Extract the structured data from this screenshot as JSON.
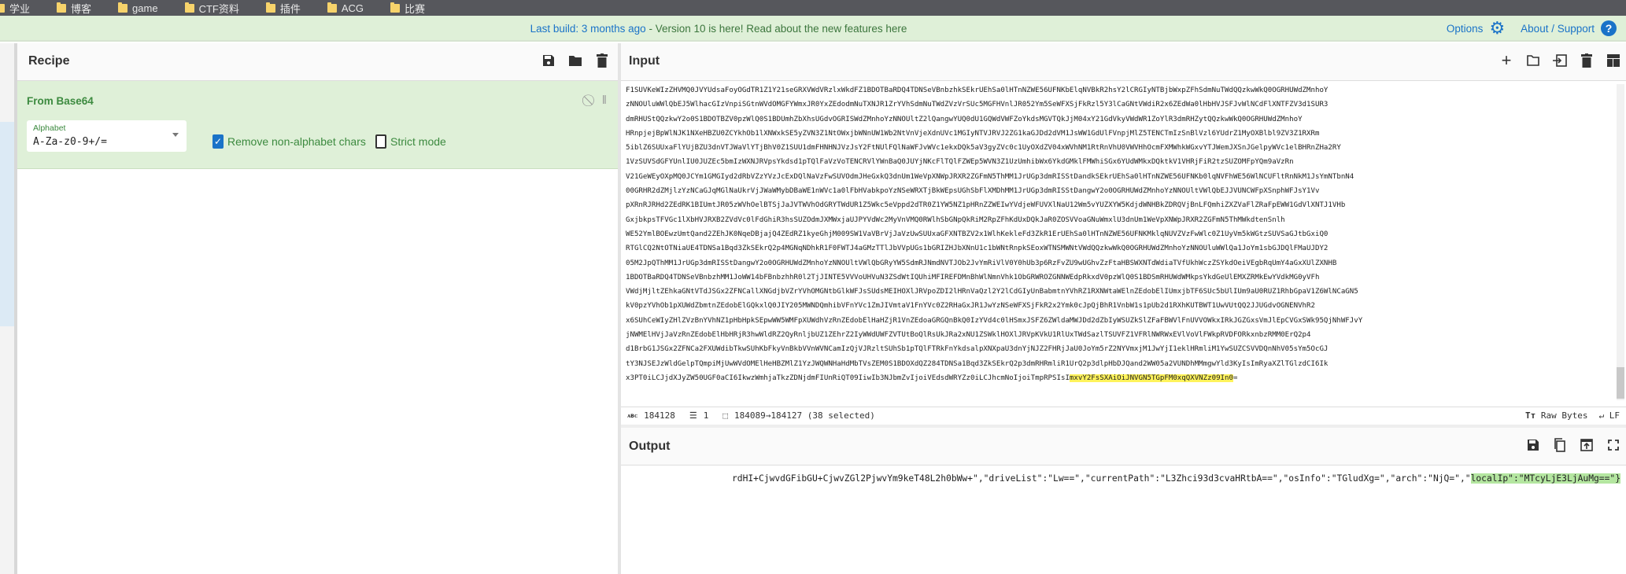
{
  "bookmarks": [
    "学业",
    "博客",
    "game",
    "CTF资料",
    "插件",
    "ACG",
    "比赛"
  ],
  "banner": {
    "last_build": "Last build: 3 months ago",
    "separator": " - ",
    "message": "Version 10 is here! Read about the new features here",
    "options": "Options",
    "about": "About / Support"
  },
  "recipe": {
    "title": "Recipe",
    "operation": {
      "name": "From Base64",
      "alphabet_label": "Alphabet",
      "alphabet_value": "A-Za-z0-9+/=",
      "remove_non_alphabet": {
        "label": "Remove non-alphabet chars",
        "checked": true
      },
      "strict_mode": {
        "label": "Strict mode",
        "checked": false
      }
    }
  },
  "input": {
    "title": "Input",
    "lines": [
      "F1SUVKeWIzZHVMQ0JVYUdsaFoyOGdTR1Z1Y21seGRXVWdVRzlxWkdFZ1BDOTBaRDQ4TDNSeVBnbzhkSEkrUEhSa0lHTnNZWE56UFNKbElqNVBkR2hsY2lCRGIyNTBjbWxpZFhSdmNuTWdQQzkwWkQ0OGRHUWdZMnhoY",
      "zNNOUluWWlQbEJ5WlhacGIzVnpiSGtnWVdOMGFYWmxJR0YxZEdodmNuTXNJR1ZrYVhSdmNuTWdZVzVrSUc5MGFHVnlJR052Ym5SeWFXSjFkRzl5Y3lCaGNtVWdiR2x6ZEdWa0lHbHVJSFJvWlNCdFlXNTFZV3d1SUR3",
      "dmRHUStQQzkwY2o0S1BDOTBZV0pzWlQ0S1BDUmhZbXhsUGdvOGRISWdZMnhoYzNNOUltZ2lQangwYUQ0dU1GQWdVWFZoYkdsMGVTQkJjM04xY21GdVkyVWdWR1ZoYlR3dmRHZytQQzkwWkQ0OGRHUWdZMnhoY",
      "HRnpjejBpWlNJK1NXeHBZU0ZCYkhOb1lXNWxkSE5yZVN3Z1NtOWxjbWNnUW1Wb2NtVnVjeXdnUVc1MGIyNTVJRVJ2ZG1kaGJDd2dVM1JsWW1GdUlFVnpjMlZ5TENCTmIzSnBlVzl6YUdrZ1MyOXBlbl9ZV3Z1RXRm",
      "5iblZ6SUUxaFlYUjBZU3dnVTJWaVlYTjBhV0Z1SUU1dmFHNHNJVzJsY2FtNUlFQlNaWFJvWVc1ekxDQk5aV3gyZVc0c1UyOXdZV04xWVhNM1RtRnVhU0VWVHhOcmFXMWhkWGxvYTJWemJXSnJGelpyWVc1elBHRnZHa2RY",
      "1VzSUVSdGFYUnlIU0JUZEc5bmIzWXNJRVpsYkdsd1pTQlFaVzVoTENCRVlYWnBaQ0JUYjNKcFlTQlFZWEp5WVN3Z1UzUmhibWx6YkdGMklFMWhiSGx6YUdWMkxDQktkV1VHRjFiR2tzSUZOMFpYQm9aVzRn",
      "V21GeWEyOXpMQ0JCYm1GMGIyd2dRbVZzYVzJcExDQlNaVzFwSUVOdmJHeGxkQ3dnUm1WeVpXNWpJRXR2ZGFmN5ThMM1JrUGp3dmRISStDandkSEkrUEhSa0lHTnNZWE56UFNKb0lqNVFhWE56WlNCUFltRnNkM1JsYmNTbnN4",
      "00GRHR2dZMjlzYzNCaGJqMGlNaUkrVjJWaWMybDBaWE1nWVc1a0lFbHVabkpoYzNSeWRXTjBkWEpsUGhSbFlXMDhMM1JrUGp3dmRISStDangwY2o0OGRHUWdZMnhoYzNNOUltVWlQbEJJVUNCWFpXSnphWFJsY1Vv",
      "pXRnRJRHd2ZEdRK1BIUmtJR05zWVhOelBTSjJaJVTWVhOdGRYTWdUR1Z5Wkc5eVppd2dTR0Z1YW5NZ1pHRnZZWEIwYVdjeWFUVXlNaU12Wm5vYUZXYW5KdjdWNHBkZDRQVjBnLFQmhiZXZVaFlZRaFpEWW1GdVlXNTJ1VHb",
      "GxjbkpsTFVGc1lXbHVJRXB2ZVdVc0lFdGhiR3hsSUZOdmJXMWxjaUJPYVdWc2MyVnVMQ0RWlhSbGNpQkRiM2RpZFhKdUxDQkJaR0ZOSVVoaGNuWmxlU3dnUm1WeVpXNWpJRXR2ZGFmN5ThMWkdtenSnlh",
      "WE52YmlBOEwzUmtQand2ZEhJK0NqeDBjajQ4ZEdRZ1kyeGhjM009SW1VaVBrVjJaVzUwSUUxaGFXNTBZV2x1WlhKekleFd3ZkR1ErUEhSa0lHTnNZWE56UFNKMklqNUVZVzFwWlc0Z1UyVm5kWGtzSUVSaGJtbGxiQ0",
      "RTGlCQ2NtOTNiaUE4TDNSa1Bqd3ZkSEkrQ2p4MGNqNDhkR1F0FWTJ4aGMzTTlJbVVpUGs1bGRIZHJbXNnU1c1bWNtRnpkSEoxWTNSMWNtVWdQQzkwWkQ0OGRHUWdZMnhoYzNNOUluWWlQa1JoYm1sbGJDQlFMaUJDY2",
      "05M2JpQThMM1JrUGp3dmRISStDangwY2o0OGRHUWdZMnhoYzNNOUltVWlQbGRyYW5SdmRJNmdNVTJOb2JvYmRiVlV0Y0hUb3p6RzFvZU9wUGhvZzFtaHBSWXNTdWdiaTVfUkhWczZSYkdOeiVEgbRqUmY4aGxXUlZXNHB",
      "1BDOTBaRDQ4TDNSeVBnbzhMM1JoWW14bFBnbzhhR0l2TjJINTE5VVVoUHVuN3ZSdWtIQUhiMFIREFDMnBhWlNmnVhk1ObGRWROZGNNWEdpRkxdV0pzWlQ0S1BDSmRHUWdWMkpsYkdGeUlEMXZRMkEwYVdkMG0yVFh",
      "VWdjMjltZEhkaGNtVTdJSGx2ZFNCallXNGdjbVZrYVhOMGNtbGlkWFJsSUdsMEIHOXlJRVpoZDI2lHRnVaQzl2Y2lCdGIyUnBabmtnYVhRZ1RXNWtaWElnZEdobElIUmxjbTF6SUc5bUlIUm9aU0RUZ1RhbGpaV1Z6WlNCaGN5",
      "kV0pzYVhOb1pXUWdZbmtnZEdobElGQkxlQ0JIY205MWNDQmhibVFnYVc1ZmJIVmtaV1FnYVc0Z2RHaGxJR1JwYzNSeWFXSjFkR2x2Ymk0cJpQjBhR1VnbW1s1pUb2d1RXhKUTBWT1UwVUtQQ2JJUGdvOGNENVhR2",
      "x6SUhCeWIyZHlZVzBnYVhNZ1pHbHpkSEpwWW5WMFpXUWdhVzRnZEdobElHaHZjR1VnZEdoaGRGQnBkQ0IzYVd4c0lHSmxJSFZ6ZWldaMWJDd2dZbIyWSUZkSlZFaFBWVlFnUVVOWkxIRkJGZGxsVmJlEpCVGxSWk95QjNhWFJvY",
      "jNWMElHVjJaVzRnZEdobElHbHRjR3hwWldRZ2QyRnljbUZ1ZEhrZ2IyWWdUWFZVTUtBoQlRsUkJRa2xNU1ZSWklHOXlJRVpKVkU1RlUxTWdSazlTSUVFZ1VFRlNWRWxEVlVoVlFWkpRVDFORkxnbzRMM0ErQ2p4",
      "d1BrbG1JSGx2ZFNCa2FXUWdibTkwSUhKbFkyVnBkbVVnWVNCamIzQjVJRzltSUhSb1pTQlFTRkFnYkdsalpXNXpaU3dnYjNJZ2FHRjJaU0JoYm5rZ2NYVmxjM1JwYjI1eklHRmliM1YwSUZCSVVDQnNhV05sYm5OcGJ",
      "tY3NJSEJzWldGelpTQmpiMjUwWVdOMElHeHBZMlZ1YzJWQWNHaHdMbTVsZEM0S1BDOXdQZ284TDNSa1Bqd3ZkSEkrQ2p3dmRHRmliR1UrQ2p3dlpHbDJQand2WW05a2VUNDhMMmgwYld3KyIsImRyaXZlTGlzdCI6Ik"
    ],
    "last_line_prefix": "x3PT0iLCJjdXJyZW50UGF0aCI6IkwzWmhjaTkzZDNjdmFIUnRiQT09IiwIb3NJbmZvIjoiVEdsdWRYZz0iLCJhcmNoIjoiTmpRPSIsI",
    "last_line_selected": "mxvY2FsSXAiOiJNVGN5TGpFM0xqQXVNZz09In0",
    "last_line_suffix": "=",
    "status": {
      "length": "184128",
      "lines": "1",
      "selection": "184089→184127 (38 selected)",
      "encoding": "Raw Bytes",
      "eol": "LF"
    }
  },
  "output": {
    "title": "Output",
    "text_prefix": "rdHI+CjwvdGFibGU+CjwvZGl2PjwvYm9keT48L2h0bWw+\",\"driveList\":\"Lw==\",\"currentPath\":\"L3Zhci93d3cvaHRtbA==\",\"osInfo\":\"TGludXg=\",\"arch\":\"NjQ=\",\"",
    "text_highlight": "localIp\":\"MTcyLjE3LjAuMg==\"}"
  },
  "colors": {
    "accent": "#1a73c8",
    "operation_bg": "#dff0d8",
    "selection": "#fff35c",
    "output_highlight": "#b4e6a0"
  }
}
